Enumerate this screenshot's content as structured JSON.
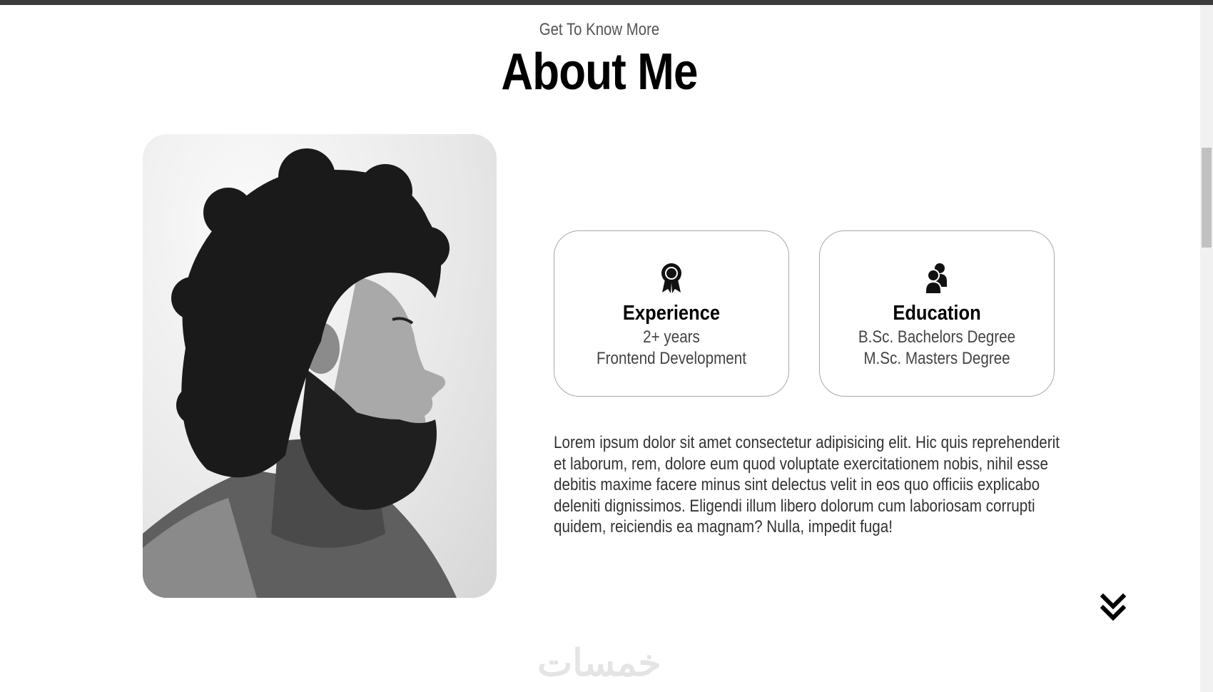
{
  "header": {
    "kicker": "Get To Know More",
    "title": "About Me"
  },
  "profile_photo": {
    "alt": "Black and white side profile portrait"
  },
  "cards": [
    {
      "icon": "award-ribbon-icon",
      "title": "Experience",
      "line1": "2+ years",
      "line2": "Frontend Development"
    },
    {
      "icon": "people-icon",
      "title": "Education",
      "line1": "B.Sc. Bachelors Degree",
      "line2": "M.Sc. Masters Degree"
    }
  ],
  "description": [
    "Lorem ipsum dolor sit amet consectetur adipisicing elit. Hic quis reprehenderit",
    "et laborum, rem, dolore eum quod voluptate exercitationem nobis, nihil esse",
    "debitis maxime facere minus sint delectus velit in eos quo officiis explicabo",
    "deleniti dignissimos. Eligendi illum libero dolorum cum laboriosam corrupti",
    "quidem, reiciendis ea magnam? Nulla, impedit fuga!"
  ],
  "scroll_icon": "double-chevron-down-icon",
  "watermark": "خمسات",
  "colors": {
    "background": "#ffffff",
    "text": "#000000",
    "muted": "#444444",
    "border": "#a8a8a8"
  }
}
